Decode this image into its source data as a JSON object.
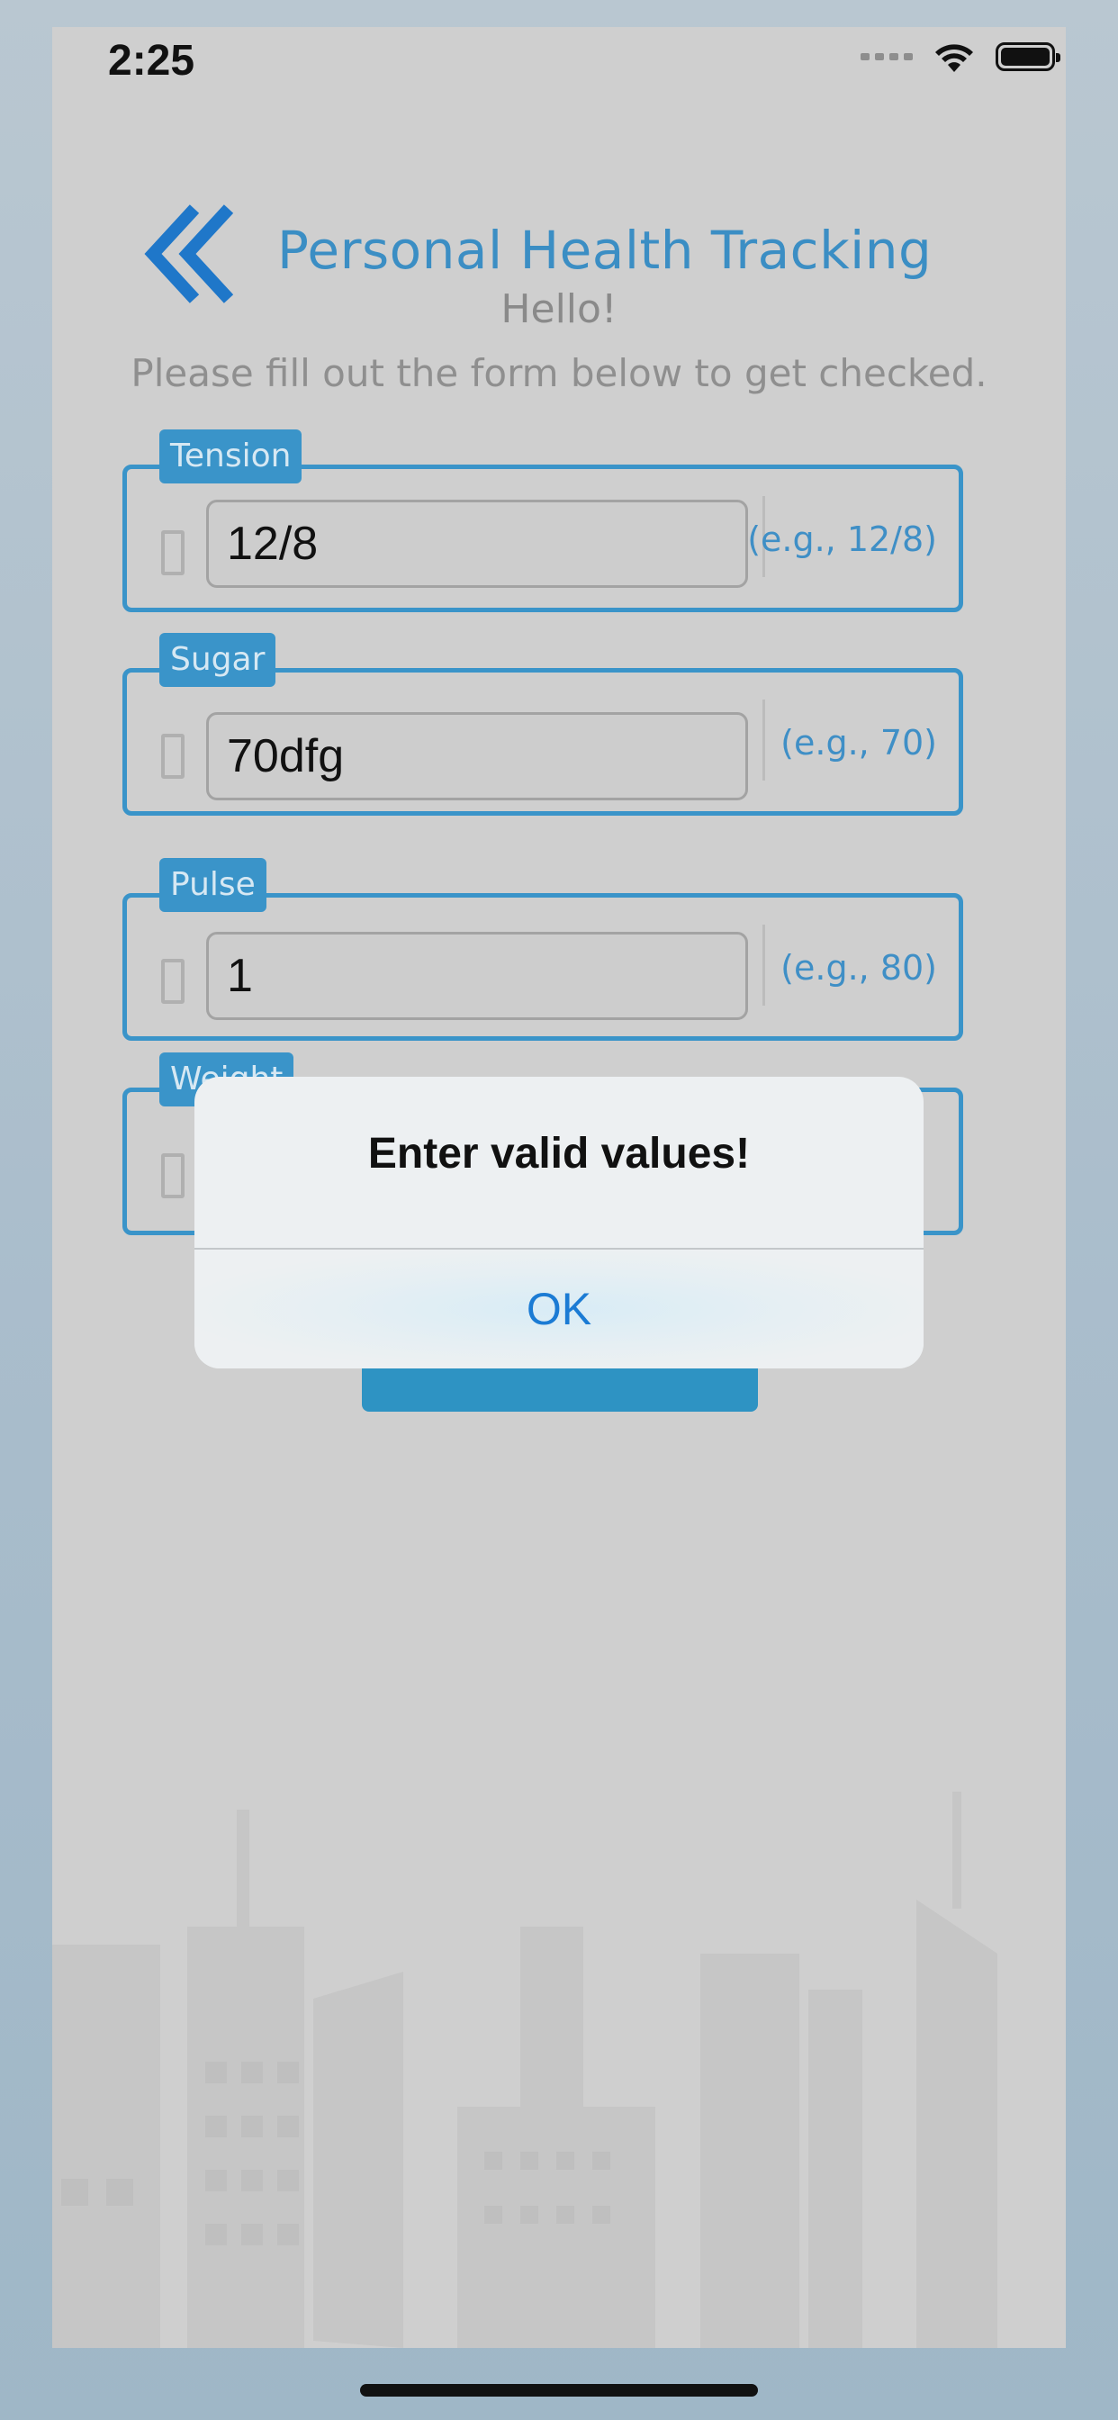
{
  "status_bar": {
    "time": "2:25"
  },
  "header": {
    "title": "Personal Health Tracking",
    "greeting": "Hello!",
    "subtitle": "Please fill out the form below to get checked."
  },
  "fields": [
    {
      "label": "Tension",
      "value": "12/8",
      "hint": "(e.g., 12/8)"
    },
    {
      "label": "Sugar",
      "value": "70dfg",
      "hint": "(e.g., 70)"
    },
    {
      "label": "Pulse",
      "value": "1",
      "hint": "(e.g., 80)"
    },
    {
      "label": "Weight",
      "value": "",
      "hint": ""
    }
  ],
  "alert": {
    "message": "Enter valid values!",
    "ok_label": "OK"
  },
  "colors": {
    "accent": "#3a94c9",
    "link": "#1b7bd4",
    "background": "#cfcfcf"
  }
}
